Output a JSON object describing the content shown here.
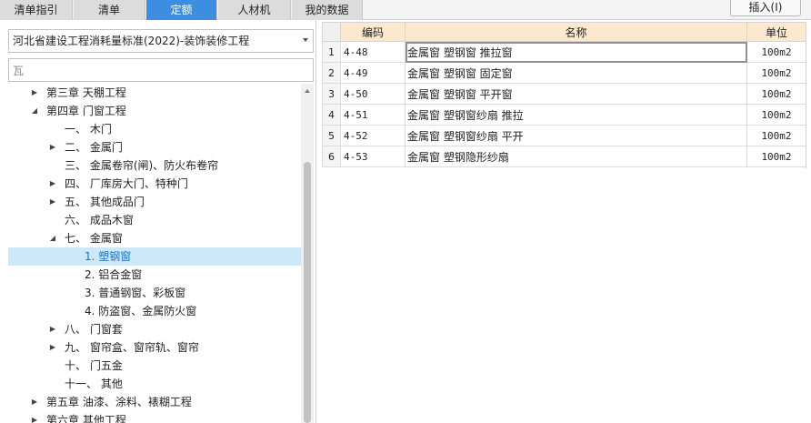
{
  "tabs": [
    {
      "label": "清单指引",
      "active": false
    },
    {
      "label": "清单",
      "active": false
    },
    {
      "label": "定额",
      "active": true
    },
    {
      "label": "人材机",
      "active": false
    },
    {
      "label": "我的数据",
      "active": false
    }
  ],
  "insert_button": "插入(I)",
  "library_select": {
    "value": "河北省建设工程消耗量标准(2022)-装饰装修工程"
  },
  "search": {
    "value": "瓦"
  },
  "tree": [
    {
      "label": "第三章 天棚工程",
      "state": "collapsed"
    },
    {
      "label": "第四章 门窗工程",
      "state": "expanded"
    },
    {
      "label": "一、 木门",
      "state": "leaf"
    },
    {
      "label": "二、 金属门",
      "state": "collapsed"
    },
    {
      "label": "三、 金属卷帘(闸)、防火布卷帘",
      "state": "leaf"
    },
    {
      "label": "四、 厂库房大门、特种门",
      "state": "collapsed"
    },
    {
      "label": "五、 其他成品门",
      "state": "collapsed"
    },
    {
      "label": "六、 成品木窗",
      "state": "leaf"
    },
    {
      "label": "七、 金属窗",
      "state": "expanded"
    },
    {
      "label": "1. 塑钢窗",
      "state": "leaf",
      "selected": true
    },
    {
      "label": "2. 铝合金窗",
      "state": "leaf"
    },
    {
      "label": "3. 普通钢窗、彩板窗",
      "state": "leaf"
    },
    {
      "label": "4. 防盗窗、金属防火窗",
      "state": "leaf"
    },
    {
      "label": "八、 门窗套",
      "state": "collapsed"
    },
    {
      "label": "九、 窗帘盒、窗帘轨、窗帘",
      "state": "collapsed"
    },
    {
      "label": "十、 门五金",
      "state": "leaf"
    },
    {
      "label": "十一、 其他",
      "state": "leaf"
    },
    {
      "label": "第五章 油漆、涂料、裱糊工程",
      "state": "collapsed"
    },
    {
      "label": "第六章 其他工程",
      "state": "collapsed"
    }
  ],
  "grid": {
    "columns": [
      "",
      "编码",
      "名称",
      "单位"
    ],
    "rows": [
      {
        "num": "1",
        "code": "4-48",
        "name": "金属窗 塑钢窗 推拉窗",
        "unit": "100m2"
      },
      {
        "num": "2",
        "code": "4-49",
        "name": "金属窗 塑钢窗 固定窗",
        "unit": "100m2"
      },
      {
        "num": "3",
        "code": "4-50",
        "name": "金属窗 塑钢窗 平开窗",
        "unit": "100m2"
      },
      {
        "num": "4",
        "code": "4-51",
        "name": "金属窗 塑钢窗纱扇 推拉",
        "unit": "100m2"
      },
      {
        "num": "5",
        "code": "4-52",
        "name": "金属窗 塑钢窗纱扇 平开",
        "unit": "100m2"
      },
      {
        "num": "6",
        "code": "4-53",
        "name": "金属窗 塑钢隐形纱扇",
        "unit": "100m2"
      }
    ]
  },
  "colors": {
    "active_tab": "#3d8ee0",
    "header_bg": "#fbe8cf",
    "selected_row": "#cde8f9"
  }
}
